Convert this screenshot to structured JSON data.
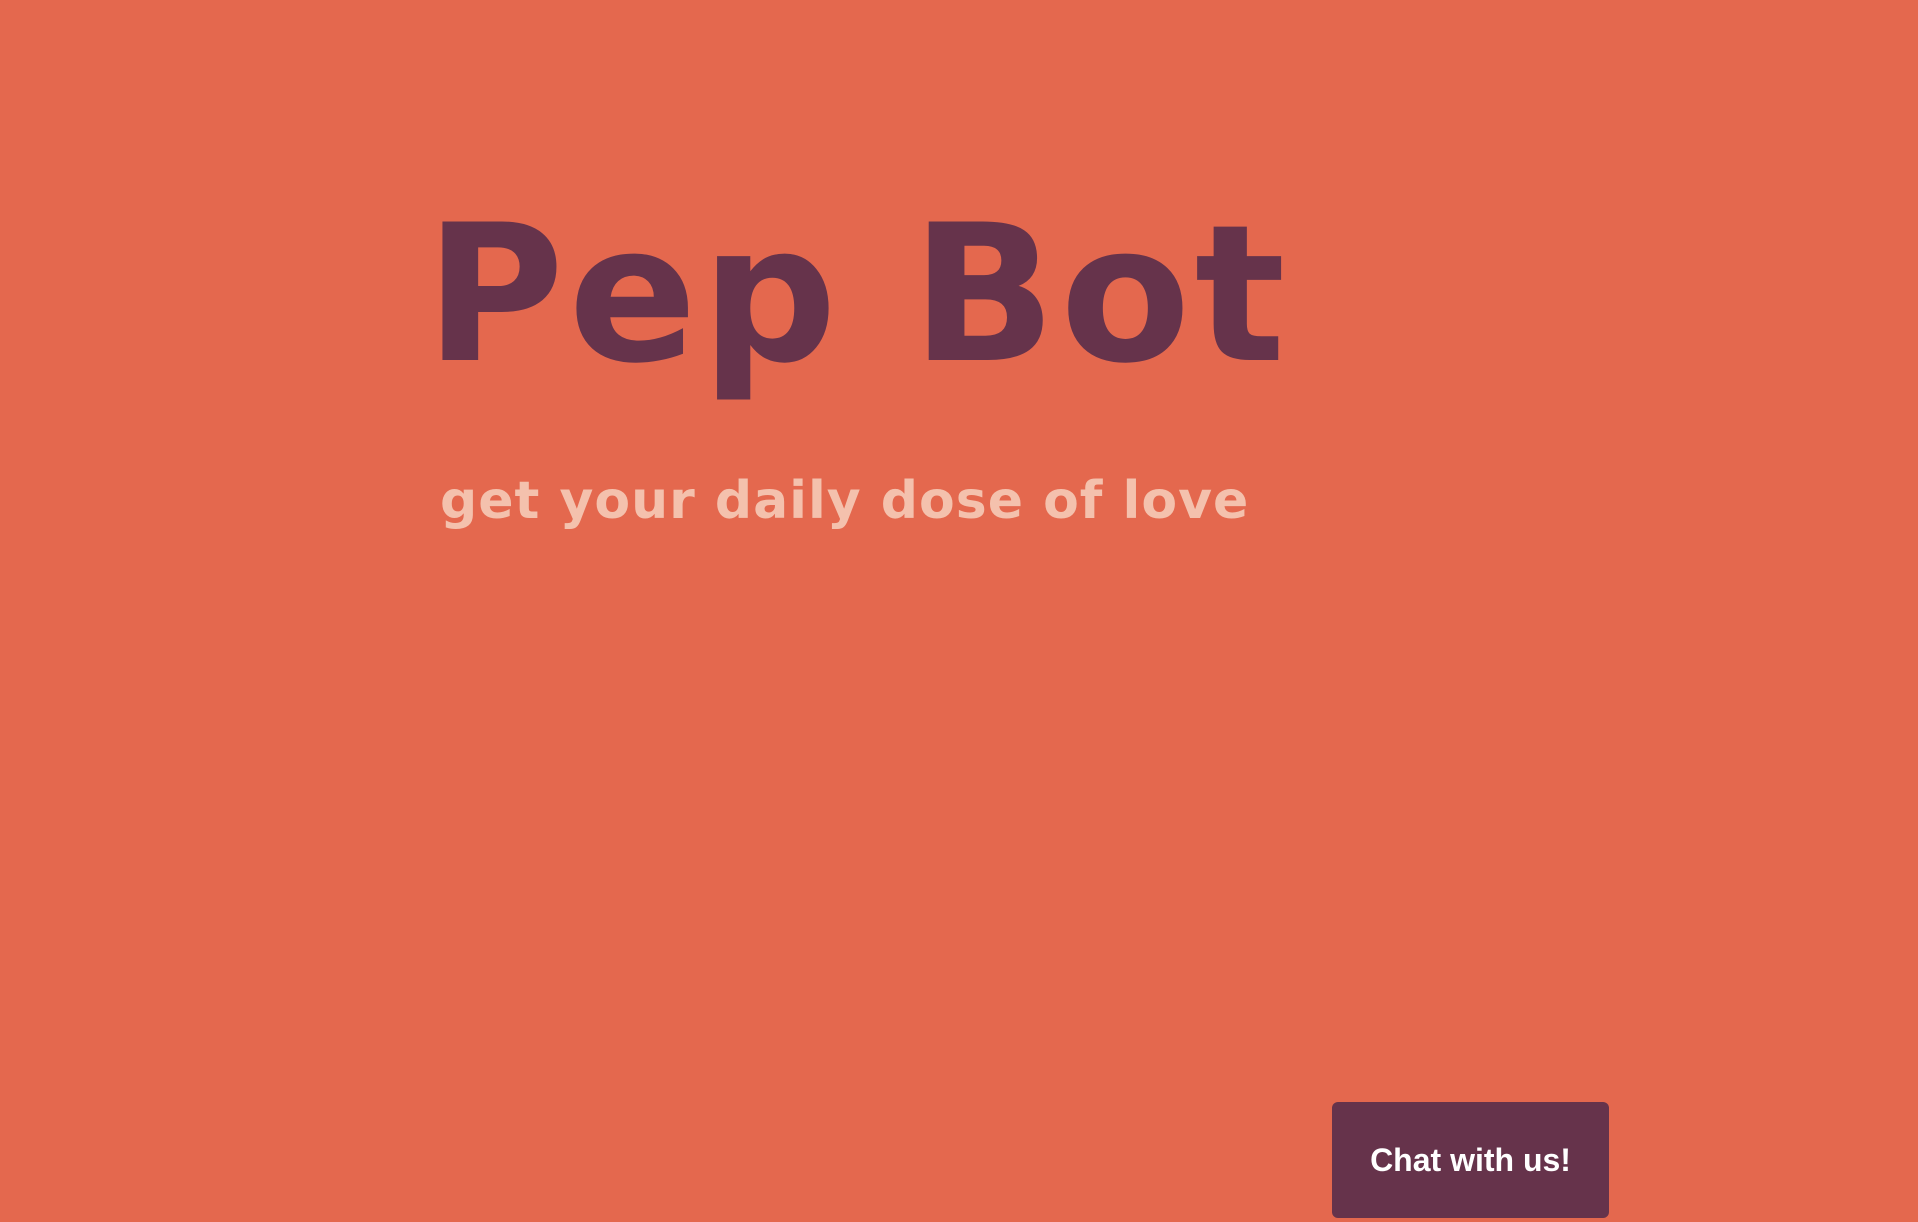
{
  "hero": {
    "title": "Pep Bot",
    "subtitle": "get your daily dose of love"
  },
  "chat": {
    "button_label": "Chat with us!"
  },
  "colors": {
    "background": "#e4684e",
    "title": "#66334b",
    "subtitle": "#f4c1ad",
    "button_bg": "#66334b",
    "button_text": "#ffffff"
  }
}
